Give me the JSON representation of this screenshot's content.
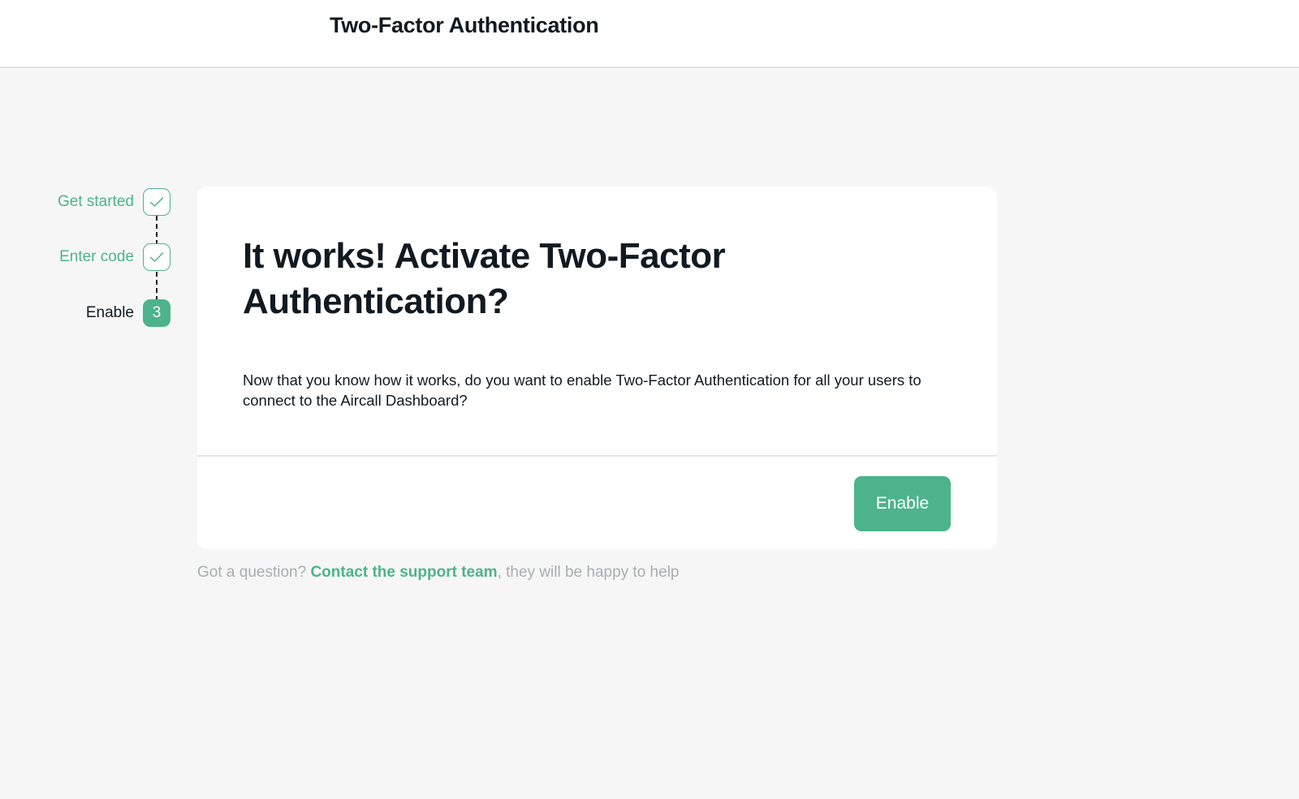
{
  "header": {
    "title": "Two-Factor Authentication"
  },
  "stepper": {
    "steps": [
      {
        "label": "Get started",
        "status": "completed",
        "marker": "check-icon"
      },
      {
        "label": "Enter code",
        "status": "completed",
        "marker": "check-icon"
      },
      {
        "label": "Enable",
        "status": "current",
        "marker": "3"
      }
    ]
  },
  "card": {
    "title": "It works! Activate Two-Factor Authentication?",
    "body": "Now that you know how it works, do you want to enable Two-Factor Authentication for all your users to connect to the Aircall Dashboard?",
    "enable_button_label": "Enable"
  },
  "help": {
    "prefix": "Got a question? ",
    "link_text": "Contact the support team",
    "suffix": ", they will be happy to help"
  },
  "colors": {
    "accent": "#4db38b",
    "text": "#111a21",
    "muted": "#a9aeb1",
    "background": "#f6f6f6",
    "surface": "#ffffff",
    "divider": "#e3e3e3"
  }
}
